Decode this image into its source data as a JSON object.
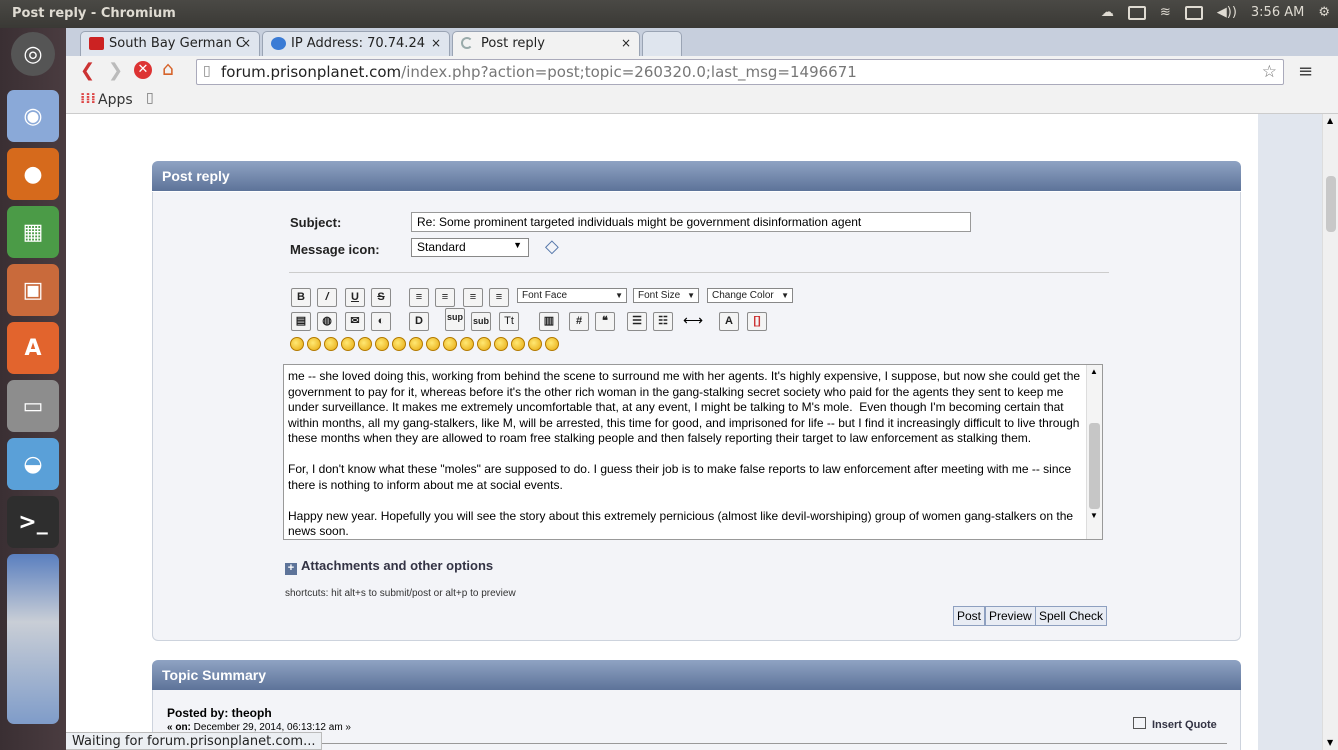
{
  "window": {
    "title": "Post reply - Chromium"
  },
  "tray": {
    "time": "3:56 AM"
  },
  "tabs": [
    {
      "label": "South Bay German C",
      "close": "×",
      "color": "#cc2222"
    },
    {
      "label": "IP Address: 70.74.24",
      "close": "×",
      "color": "#3a7bd5"
    },
    {
      "label": "Post reply",
      "close": "×",
      "color": "#9aa"
    }
  ],
  "toolbar": {
    "url_host": "forum.prisonplanet.com",
    "url_path": "/index.php?action=post;topic=260320.0;last_msg=1496671"
  },
  "bookmarks": {
    "apps_label": "Apps"
  },
  "post": {
    "header": "Post reply",
    "subject_label": "Subject:",
    "subject_value": "Re: Some prominent targeted individuals might be government disinformation agent",
    "icon_label": "Message icon:",
    "icon_value": "Standard",
    "font_face": "Font Face",
    "font_size": "Font Size",
    "change_color": "Change Color",
    "message": "me -- she loved doing this, working from behind the scene to surround me with her agents. It's highly expensive, I suppose, but now she could get the government to pay for it, whereas before it's the other rich woman in the gang-stalking secret society who paid for the agents they sent to keep me under surveillance. It makes me extremely uncomfortable that, at any event, I might be talking to M's mole.  Even though I'm becoming certain that within months, all my gang-stalkers, like M, will be arrested, this time for good, and imprisoned for life -- but I find it increasingly difficult to live through these months when they are allowed to roam free stalking people and then falsely reporting their target to law enforcement as stalking them.\n\nFor, I don't know what these \"moles\" are supposed to do. I guess their job is to make false reports to law enforcement after meeting with me -- since there is nothing to inform about me at social events.\n\nHappy new year. Hopefully you will see the story about this extremely pernicious (almost like devil-worshiping) group of women gang-stalkers on the news soon.",
    "attachments": "Attachments and other options",
    "shortcuts": "shortcuts: hit alt+s to submit/post or alt+p to preview",
    "post_btn": "Post",
    "preview_btn": "Preview",
    "spell_btn": "Spell Check"
  },
  "summary": {
    "header": "Topic Summary",
    "posted_by": "Posted by: theoph",
    "on_label": "« on:",
    "on_date": "December 29, 2014, 06:13:12 am »",
    "insert_quote": "Insert Quote"
  },
  "status": "Waiting for forum.prisonplanet.com..."
}
